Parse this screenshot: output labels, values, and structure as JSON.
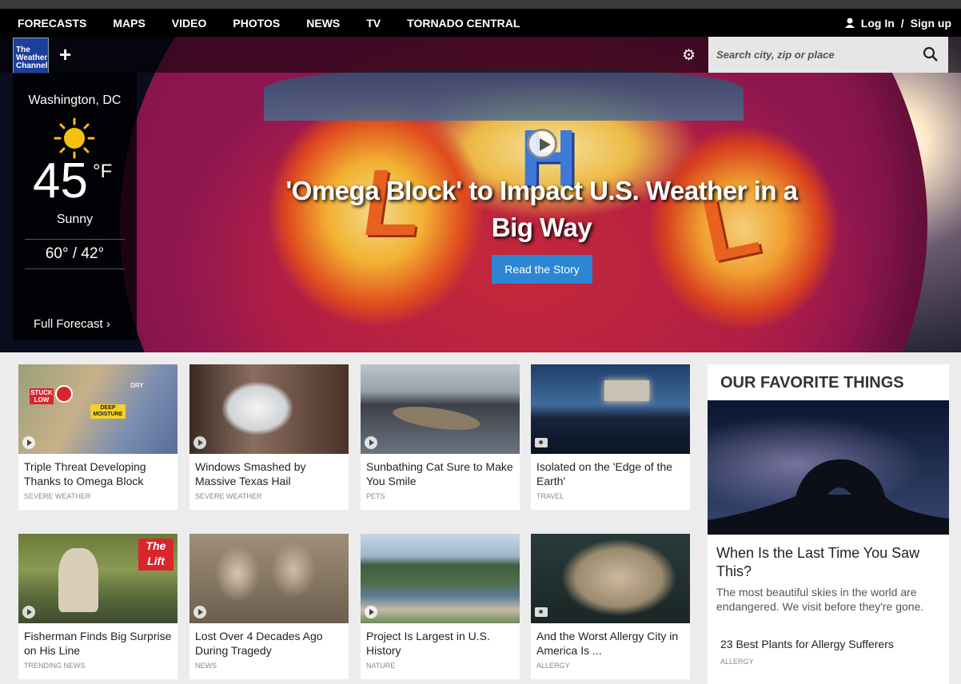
{
  "nav": {
    "items": [
      "FORECASTS",
      "MAPS",
      "VIDEO",
      "PHOTOS",
      "NEWS",
      "TV",
      "TORNADO CENTRAL"
    ],
    "login": "Log In",
    "separator": "/",
    "signup": "Sign up"
  },
  "brand": {
    "logo_line1": "The",
    "logo_line2": "Weather",
    "logo_line3": "Channel"
  },
  "search": {
    "placeholder": "Search city, zip or place"
  },
  "weather": {
    "city": "Washington, DC",
    "temp": "45",
    "unit": "°F",
    "condition": "Sunny",
    "range": "60° / 42°",
    "full_forecast": "Full Forecast"
  },
  "hero": {
    "headline": "'Omega Block' to Impact U.S. Weather in a Big Way",
    "button": "Read the Story",
    "map_letters": [
      "L",
      "H",
      "L"
    ]
  },
  "cards": [
    {
      "title": "Triple Threat Developing Thanks to Omega Block",
      "category": "SEVERE WEATHER",
      "media": "video",
      "overlay": [
        "STUCK LOW",
        "DEEP MOISTURE",
        "DRY"
      ]
    },
    {
      "title": "Windows Smashed by Massive Texas Hail",
      "category": "SEVERE WEATHER",
      "media": "video"
    },
    {
      "title": "Sunbathing Cat Sure to Make You Smile",
      "category": "PETS",
      "media": "video"
    },
    {
      "title": "Isolated on the 'Edge of the Earth'",
      "category": "TRAVEL",
      "media": "photo"
    },
    {
      "title": "Fisherman Finds Big Surprise on His Line",
      "category": "TRENDING NEWS",
      "media": "video",
      "overlay": [
        "The Lift"
      ]
    },
    {
      "title": "Lost Over 4 Decades Ago During Tragedy",
      "category": "NEWS",
      "media": "video"
    },
    {
      "title": "Project Is Largest in U.S. History",
      "category": "NATURE",
      "media": "video"
    },
    {
      "title": "And the Worst Allergy City in America Is ...",
      "category": "ALLERGY",
      "media": "photo"
    }
  ],
  "favorites": {
    "heading": "OUR FAVORITE THINGS",
    "title": "When Is the Last Time You Saw This?",
    "description": "The most beautiful skies in the world are endangered. We visit before they're gone.",
    "link": "23 Best Plants for Allergy Sufferers",
    "link_category": "ALLERGY"
  },
  "colors": {
    "accent": "#2b86d3",
    "nav_bg": "#000000",
    "page_bg": "#ececec"
  }
}
